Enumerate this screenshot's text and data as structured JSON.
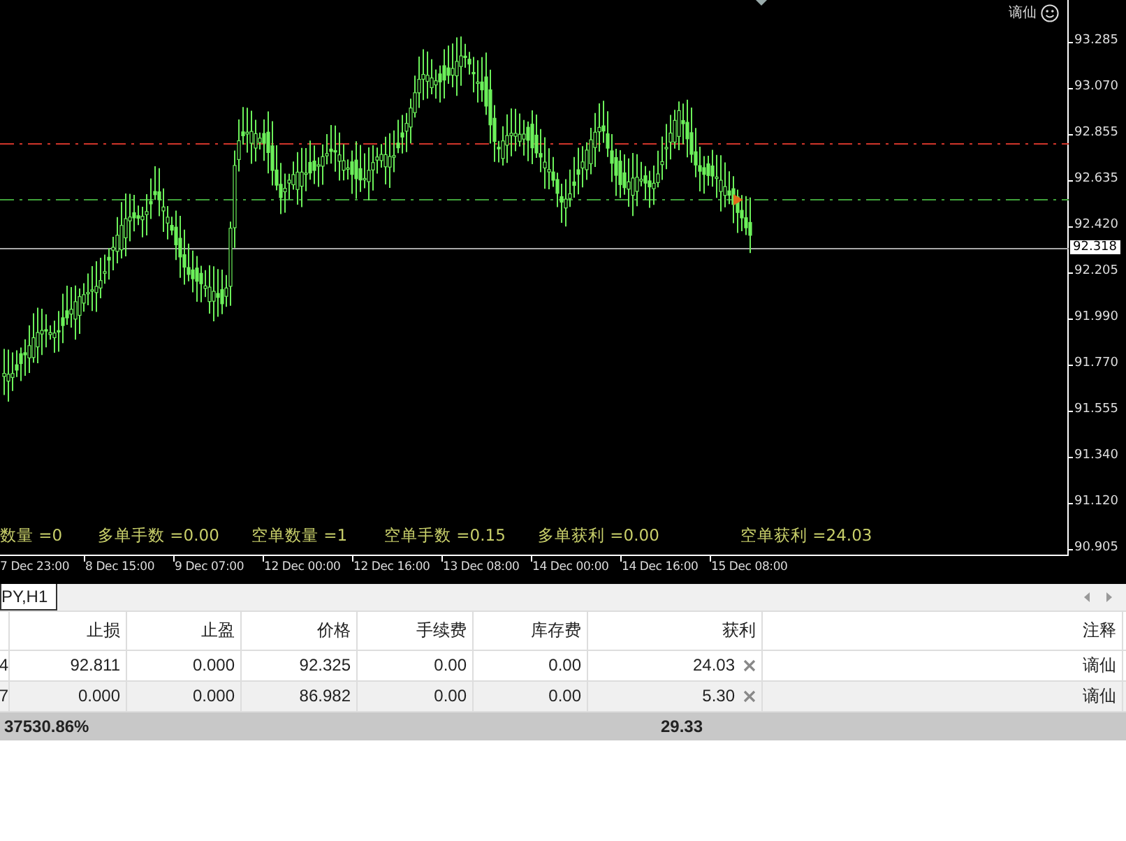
{
  "chart": {
    "account_label": "谪仙",
    "price_axis": [
      "93.285",
      "93.070",
      "92.855",
      "92.635",
      "92.420",
      "92.205",
      "91.990",
      "91.770",
      "91.555",
      "91.340",
      "91.120",
      "90.905"
    ],
    "current_price": "92.318",
    "time_axis": [
      "7 Dec 23:00",
      "8 Dec 15:00",
      "9 Dec 07:00",
      "12 Dec 00:00",
      "12 Dec 16:00",
      "13 Dec 08:00",
      "14 Dec 00:00",
      "14 Dec 16:00",
      "15 Dec 08:00"
    ],
    "info_items": [
      {
        "label": "数量",
        "value": "=0"
      },
      {
        "label": "多单手数",
        "value": "=0.00"
      },
      {
        "label": "空单数量",
        "value": "=1"
      },
      {
        "label": "空单手数",
        "value": "=0.15"
      },
      {
        "label": "多单获利",
        "value": "=0.00"
      },
      {
        "label": "空单获利",
        "value": "=24.03"
      }
    ]
  },
  "tabs": [
    {
      "label": "PY,H1",
      "selected": true
    }
  ],
  "table": {
    "columns": [
      "止损",
      "止盈",
      "价格",
      "手续费",
      "库存费",
      "获利",
      "注释"
    ],
    "rows": [
      {
        "column_1": "4",
        "cells": [
          "92.811",
          "0.000",
          "92.325",
          "0.00",
          "0.00",
          "24.03",
          "谪仙"
        ]
      },
      {
        "column_1": "7",
        "cells": [
          "0.000",
          "0.000",
          "86.982",
          "0.00",
          "0.00",
          "5.30",
          "谪仙"
        ]
      }
    ],
    "summary": {
      "balance": "37530.86%",
      "profit": "29.33"
    }
  }
}
